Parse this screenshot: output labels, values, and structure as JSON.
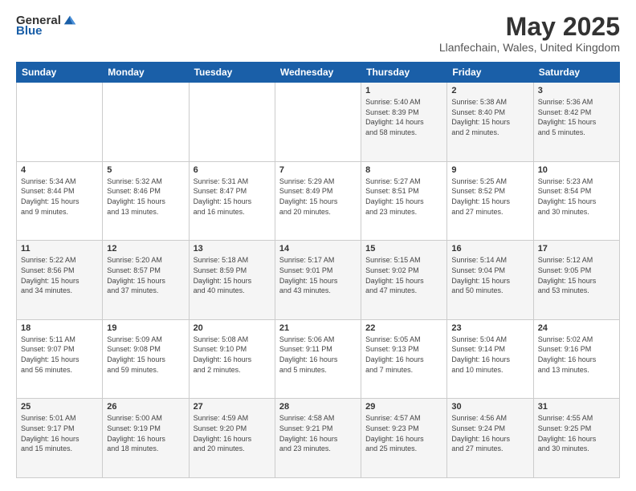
{
  "header": {
    "logo": {
      "general": "General",
      "blue": "Blue"
    },
    "title": "May 2025",
    "location": "Llanfechain, Wales, United Kingdom"
  },
  "weekdays": [
    "Sunday",
    "Monday",
    "Tuesday",
    "Wednesday",
    "Thursday",
    "Friday",
    "Saturday"
  ],
  "weeks": [
    [
      {
        "day": "",
        "info": ""
      },
      {
        "day": "",
        "info": ""
      },
      {
        "day": "",
        "info": ""
      },
      {
        "day": "",
        "info": ""
      },
      {
        "day": "1",
        "info": "Sunrise: 5:40 AM\nSunset: 8:39 PM\nDaylight: 14 hours\nand 58 minutes."
      },
      {
        "day": "2",
        "info": "Sunrise: 5:38 AM\nSunset: 8:40 PM\nDaylight: 15 hours\nand 2 minutes."
      },
      {
        "day": "3",
        "info": "Sunrise: 5:36 AM\nSunset: 8:42 PM\nDaylight: 15 hours\nand 5 minutes."
      }
    ],
    [
      {
        "day": "4",
        "info": "Sunrise: 5:34 AM\nSunset: 8:44 PM\nDaylight: 15 hours\nand 9 minutes."
      },
      {
        "day": "5",
        "info": "Sunrise: 5:32 AM\nSunset: 8:46 PM\nDaylight: 15 hours\nand 13 minutes."
      },
      {
        "day": "6",
        "info": "Sunrise: 5:31 AM\nSunset: 8:47 PM\nDaylight: 15 hours\nand 16 minutes."
      },
      {
        "day": "7",
        "info": "Sunrise: 5:29 AM\nSunset: 8:49 PM\nDaylight: 15 hours\nand 20 minutes."
      },
      {
        "day": "8",
        "info": "Sunrise: 5:27 AM\nSunset: 8:51 PM\nDaylight: 15 hours\nand 23 minutes."
      },
      {
        "day": "9",
        "info": "Sunrise: 5:25 AM\nSunset: 8:52 PM\nDaylight: 15 hours\nand 27 minutes."
      },
      {
        "day": "10",
        "info": "Sunrise: 5:23 AM\nSunset: 8:54 PM\nDaylight: 15 hours\nand 30 minutes."
      }
    ],
    [
      {
        "day": "11",
        "info": "Sunrise: 5:22 AM\nSunset: 8:56 PM\nDaylight: 15 hours\nand 34 minutes."
      },
      {
        "day": "12",
        "info": "Sunrise: 5:20 AM\nSunset: 8:57 PM\nDaylight: 15 hours\nand 37 minutes."
      },
      {
        "day": "13",
        "info": "Sunrise: 5:18 AM\nSunset: 8:59 PM\nDaylight: 15 hours\nand 40 minutes."
      },
      {
        "day": "14",
        "info": "Sunrise: 5:17 AM\nSunset: 9:01 PM\nDaylight: 15 hours\nand 43 minutes."
      },
      {
        "day": "15",
        "info": "Sunrise: 5:15 AM\nSunset: 9:02 PM\nDaylight: 15 hours\nand 47 minutes."
      },
      {
        "day": "16",
        "info": "Sunrise: 5:14 AM\nSunset: 9:04 PM\nDaylight: 15 hours\nand 50 minutes."
      },
      {
        "day": "17",
        "info": "Sunrise: 5:12 AM\nSunset: 9:05 PM\nDaylight: 15 hours\nand 53 minutes."
      }
    ],
    [
      {
        "day": "18",
        "info": "Sunrise: 5:11 AM\nSunset: 9:07 PM\nDaylight: 15 hours\nand 56 minutes."
      },
      {
        "day": "19",
        "info": "Sunrise: 5:09 AM\nSunset: 9:08 PM\nDaylight: 15 hours\nand 59 minutes."
      },
      {
        "day": "20",
        "info": "Sunrise: 5:08 AM\nSunset: 9:10 PM\nDaylight: 16 hours\nand 2 minutes."
      },
      {
        "day": "21",
        "info": "Sunrise: 5:06 AM\nSunset: 9:11 PM\nDaylight: 16 hours\nand 5 minutes."
      },
      {
        "day": "22",
        "info": "Sunrise: 5:05 AM\nSunset: 9:13 PM\nDaylight: 16 hours\nand 7 minutes."
      },
      {
        "day": "23",
        "info": "Sunrise: 5:04 AM\nSunset: 9:14 PM\nDaylight: 16 hours\nand 10 minutes."
      },
      {
        "day": "24",
        "info": "Sunrise: 5:02 AM\nSunset: 9:16 PM\nDaylight: 16 hours\nand 13 minutes."
      }
    ],
    [
      {
        "day": "25",
        "info": "Sunrise: 5:01 AM\nSunset: 9:17 PM\nDaylight: 16 hours\nand 15 minutes."
      },
      {
        "day": "26",
        "info": "Sunrise: 5:00 AM\nSunset: 9:19 PM\nDaylight: 16 hours\nand 18 minutes."
      },
      {
        "day": "27",
        "info": "Sunrise: 4:59 AM\nSunset: 9:20 PM\nDaylight: 16 hours\nand 20 minutes."
      },
      {
        "day": "28",
        "info": "Sunrise: 4:58 AM\nSunset: 9:21 PM\nDaylight: 16 hours\nand 23 minutes."
      },
      {
        "day": "29",
        "info": "Sunrise: 4:57 AM\nSunset: 9:23 PM\nDaylight: 16 hours\nand 25 minutes."
      },
      {
        "day": "30",
        "info": "Sunrise: 4:56 AM\nSunset: 9:24 PM\nDaylight: 16 hours\nand 27 minutes."
      },
      {
        "day": "31",
        "info": "Sunrise: 4:55 AM\nSunset: 9:25 PM\nDaylight: 16 hours\nand 30 minutes."
      }
    ]
  ]
}
